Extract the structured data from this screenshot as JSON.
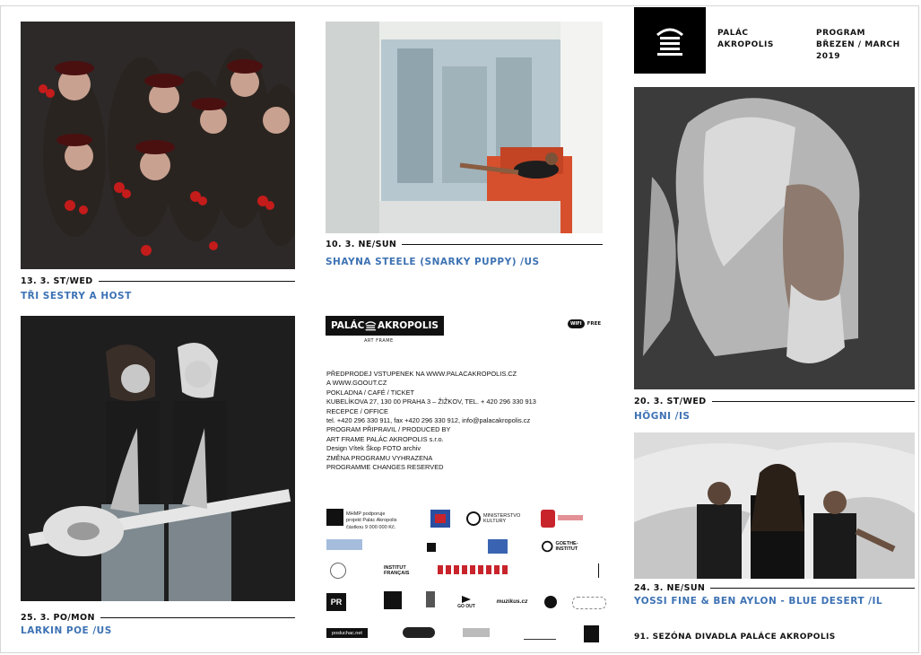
{
  "header": {
    "brand_line1": "PALÁC",
    "brand_line2": "AKROPOLIS",
    "program_line1": "PROGRAM",
    "program_line2": "BŘEZEN / MARCH",
    "program_line3": "2019"
  },
  "events": [
    {
      "date": "13. 3. ST/WED",
      "title": "TŘI SESTRY A HOST"
    },
    {
      "date": "10. 3. NE/SUN",
      "title": "SHAYNA STEELE (SNARKY PUPPY) /US"
    },
    {
      "date": "20. 3. ST/WED",
      "title": "HÖGNI /IS"
    },
    {
      "date": "25. 3.  PO/MON",
      "title": "LARKIN POE /US"
    },
    {
      "date": "24. 3. NE/SUN",
      "title": "YOSSI FINE & BEN AYLON - BLUE DESERT /IL"
    }
  ],
  "brand_logo": {
    "left": "PALÁC",
    "right": "AKROPOLIS",
    "sub": "ART FRAME"
  },
  "wifi": {
    "label": "WIFI",
    "free": "FREE"
  },
  "info_lines": [
    "PŘEDPRODEJ VSTUPENEK NA WWW.PALACAKROPOLIS.CZ",
    "A WWW.GOOUT.CZ",
    "POKLADNA / CAFÉ / TICKET",
    "KUBELÍKOVA 27, 130 00 PRAHA 3 – ŽIŽKOV, TEL. + 420 296 330 913",
    "RECEPCE / OFFICE",
    "tel. +420 296 330 911, fax +420 296 330 912, info@palacakropolis.cz",
    "PROGRAM PŘIPRAVIL / PRODUCED BY",
    "ART FRAME PALÁC AKROPOLIS s.r.o.",
    "Design Vítek Škop FOTO archiv",
    "ZMĚNA PROGRAMU VYHRAZENA",
    "PROGRAMME CHANGES RESERVED"
  ],
  "mhmp_lines": [
    "MHMP podporuje",
    "projekt Palác Akropolis",
    "částkou 9 000 000 Kč."
  ],
  "sponsors": {
    "ministry": "MINISTERSTVO KULTURY",
    "goethe": "GOETHE-INSTITUT",
    "institut": "INSTITUT FRANÇAIS",
    "pr": "PR",
    "goout": "GO OUT",
    "muzikus": "muzikus.cz",
    "posluchac": "posluchac.net"
  },
  "footer": "91. SEZÓNA DIVADLA PALÁCE AKROPOLIS"
}
